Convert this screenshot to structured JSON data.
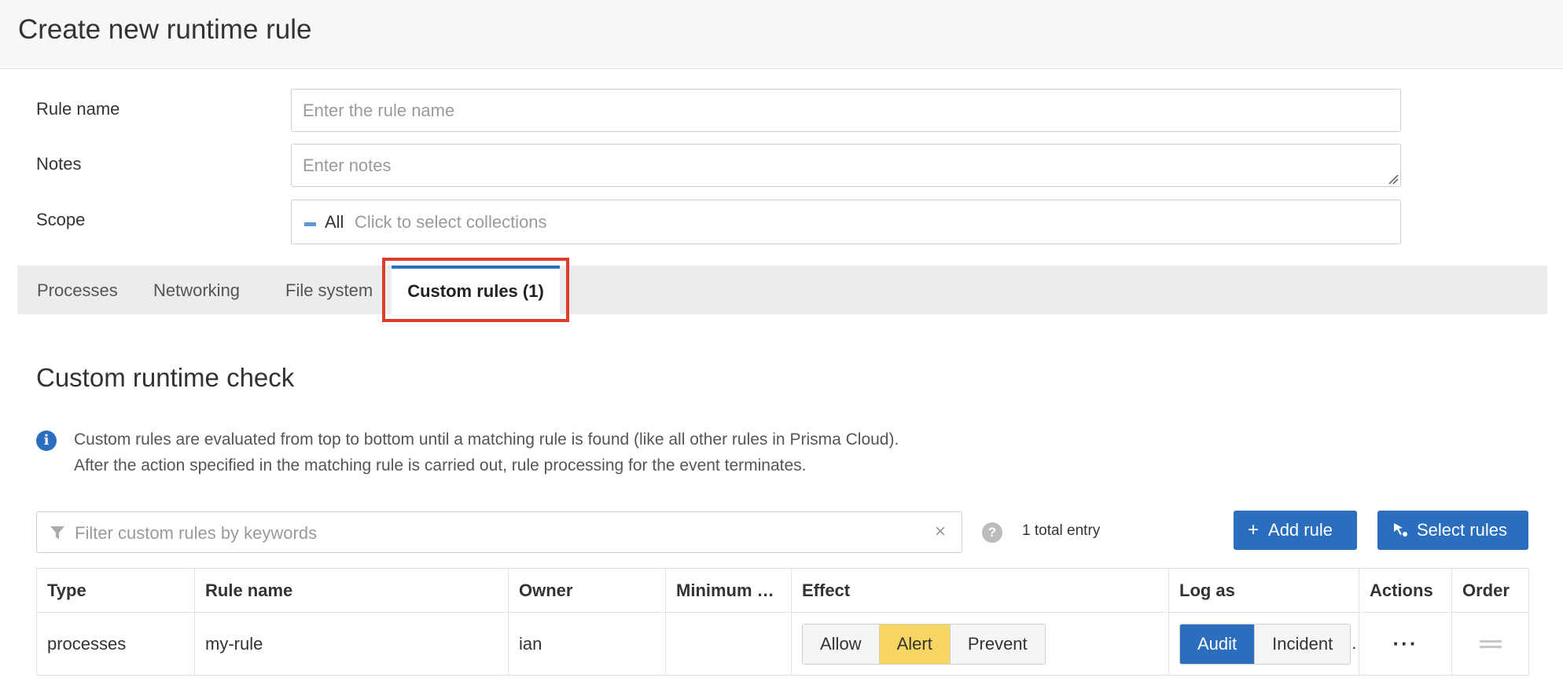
{
  "page": {
    "title": "Create new runtime rule"
  },
  "form": {
    "rule_name_label": "Rule name",
    "rule_name_placeholder": "Enter the rule name",
    "notes_label": "Notes",
    "notes_placeholder": "Enter notes",
    "scope_label": "Scope",
    "scope_value": "All",
    "scope_placeholder": "Click to select collections"
  },
  "tabs": [
    {
      "label": "Processes"
    },
    {
      "label": "Networking"
    },
    {
      "label": "File system"
    },
    {
      "label": "Custom rules (1)",
      "active": true
    }
  ],
  "section": {
    "title": "Custom runtime check",
    "info_line1": "Custom rules are evaluated from top to bottom until a matching rule is found (like all other rules in Prisma Cloud).",
    "info_line2": "After the action specified in the matching rule is carried out, rule processing for the event terminates."
  },
  "toolbar": {
    "filter_placeholder": "Filter custom rules by keywords",
    "total": "1 total entry",
    "add_rule": "Add rule",
    "select_rules": "Select rules"
  },
  "table": {
    "columns": [
      "Type",
      "Rule name",
      "Owner",
      "Minimum d...",
      "Effect",
      "Log as",
      "Actions",
      "Order"
    ],
    "rows": [
      {
        "type": "processes",
        "rule_name": "my-rule",
        "owner": "ian",
        "minimum": "",
        "effect_options": [
          "Allow",
          "Alert",
          "Prevent"
        ],
        "effect_selected": "Alert",
        "log_options": [
          "Audit",
          "Incident"
        ],
        "log_selected": "Audit",
        "actions": "···"
      }
    ]
  },
  "colors": {
    "accent": "#2a6ebd",
    "highlight_box": "#e03c2b",
    "alert_selected": "#f7d562"
  },
  "icons": {
    "info": "info-icon",
    "help": "help-icon",
    "filter": "funnel-icon",
    "clear": "close-icon",
    "add": "plus-icon",
    "select": "cursor-select-icon",
    "order": "drag-handle-icon"
  }
}
